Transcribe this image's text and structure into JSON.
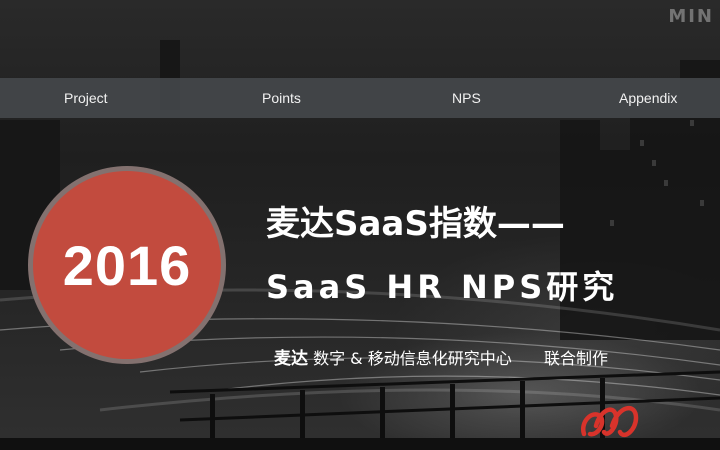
{
  "top_logo": "MIN",
  "nav": {
    "items": [
      {
        "label": "Project"
      },
      {
        "label": "Points"
      },
      {
        "label": "NPS"
      },
      {
        "label": "Appendix"
      }
    ]
  },
  "badge": {
    "year": "2016",
    "color": "#c24b3e"
  },
  "title": {
    "line1": "麦达SaaS指数——",
    "line2": "SaaS HR NPS研究"
  },
  "subtitle": {
    "brand": "麦达",
    "org": "数字 & 移动信息化研究中心",
    "suffix": "联合制作"
  },
  "colors": {
    "accent": "#c24b3e",
    "nav_bg": "#464a4e",
    "text": "#ffffff"
  },
  "icons": {
    "logo": "maida-logo-icon"
  }
}
